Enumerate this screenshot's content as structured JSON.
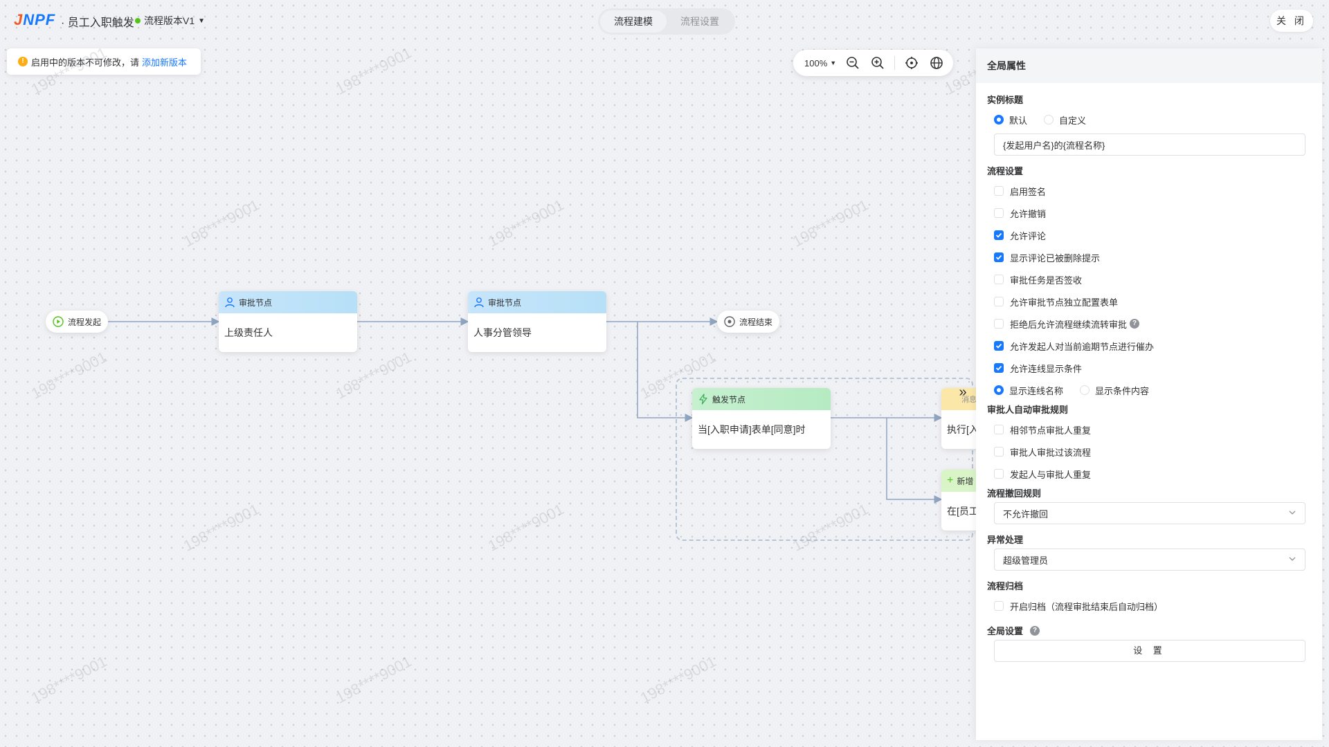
{
  "app": {
    "logo_part1": "J",
    "logo_part2": "NPF",
    "title": "· 员工入职触发",
    "version": "流程版本V1"
  },
  "tabs": [
    {
      "label": "流程建模",
      "active": true
    },
    {
      "label": "流程设置",
      "active": false
    }
  ],
  "close_label": "关 闭",
  "notice": {
    "text": "启用中的版本不可修改，请",
    "link": "添加新版本"
  },
  "zoom": {
    "value": "100%"
  },
  "flow": {
    "start": "流程发起",
    "end": "流程结束",
    "approval1": {
      "header": "审批节点",
      "body": "上级责任人"
    },
    "approval2": {
      "header": "审批节点",
      "body": "人事分管领导"
    },
    "trigger": {
      "header": "触发节点",
      "body": "当[入职申请]表单[同意]时"
    },
    "exec": {
      "header": "消息",
      "body": "执行[入"
    },
    "create": {
      "header": "新增",
      "body": "在[员工"
    }
  },
  "watermark": "198****9001",
  "panel": {
    "title": "全局属性",
    "instance_title": {
      "label": "实例标题",
      "options": [
        {
          "label": "默认",
          "checked": true
        },
        {
          "label": "自定义",
          "checked": false
        }
      ],
      "value": "{发起用户名}的{流程名称}"
    },
    "process_settings": {
      "label": "流程设置",
      "items": [
        {
          "label": "启用签名",
          "checked": false
        },
        {
          "label": "允许撤销",
          "checked": false
        },
        {
          "label": "允许评论",
          "checked": true
        },
        {
          "label": "显示评论已被删除提示",
          "checked": true
        },
        {
          "label": "审批任务是否签收",
          "checked": false
        },
        {
          "label": "允许审批节点独立配置表单",
          "checked": false
        },
        {
          "label": "拒绝后允许流程继续流转审批",
          "checked": false,
          "help": true
        },
        {
          "label": "允许发起人对当前逾期节点进行催办",
          "checked": true
        },
        {
          "label": "允许连线显示条件",
          "checked": true
        }
      ],
      "line_options": [
        {
          "label": "显示连线名称",
          "checked": true
        },
        {
          "label": "显示条件内容",
          "checked": false
        }
      ]
    },
    "auto_approve": {
      "label": "审批人自动审批规则",
      "items": [
        {
          "label": "相邻节点审批人重复",
          "checked": false
        },
        {
          "label": "审批人审批过该流程",
          "checked": false
        },
        {
          "label": "发起人与审批人重复",
          "checked": false
        }
      ]
    },
    "revoke": {
      "label": "流程撤回规则",
      "value": "不允许撤回"
    },
    "exception": {
      "label": "异常处理",
      "value": "超级管理员"
    },
    "archive": {
      "label": "流程归档",
      "item": {
        "label": "开启归档（流程审批结束后自动归档）",
        "checked": false
      }
    },
    "global": {
      "label": "全局设置",
      "button": "设 置"
    }
  }
}
